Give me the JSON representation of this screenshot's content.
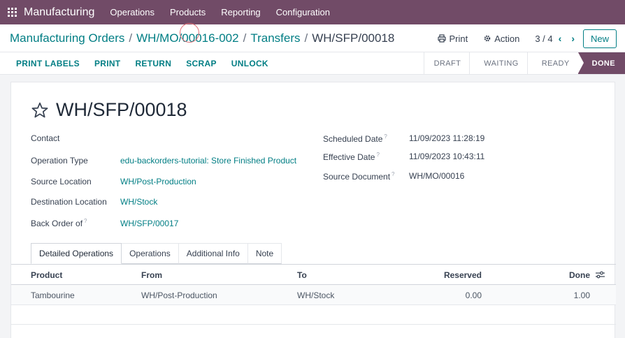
{
  "topbar": {
    "app_name": "Manufacturing",
    "menu": [
      "Operations",
      "Products",
      "Reporting",
      "Configuration"
    ]
  },
  "breadcrumb": {
    "items": [
      "Manufacturing Orders",
      "WH/MO/00016-002",
      "Transfers"
    ],
    "current": "WH/SFP/00018",
    "separator": "/"
  },
  "controls": {
    "print_label": "Print",
    "action_label": "Action",
    "pager": "3 / 4",
    "new_label": "New"
  },
  "actions": [
    "PRINT LABELS",
    "PRINT",
    "RETURN",
    "SCRAP",
    "UNLOCK"
  ],
  "stages": [
    "DRAFT",
    "WAITING",
    "READY",
    "DONE"
  ],
  "record": {
    "title": "WH/SFP/00018",
    "left_fields": [
      {
        "label": "Contact",
        "value": ""
      },
      {
        "label": "Operation Type",
        "value": "edu-backorders-tutorial: Store Finished Product"
      },
      {
        "label": "Source Location",
        "value": "WH/Post-Production"
      },
      {
        "label": "Destination Location",
        "value": "WH/Stock"
      },
      {
        "label": "Back Order of",
        "value": "WH/SFP/00017"
      }
    ],
    "right_fields": [
      {
        "label": "Scheduled Date",
        "value": "11/09/2023 11:28:19"
      },
      {
        "label": "Effective Date",
        "value": "11/09/2023 10:43:11"
      },
      {
        "label": "Source Document",
        "value": "WH/MO/00016"
      }
    ],
    "help_mark": "?"
  },
  "tabs": [
    "Detailed Operations",
    "Operations",
    "Additional Info",
    "Note"
  ],
  "table": {
    "headers": [
      "Product",
      "From",
      "To",
      "Reserved",
      "Done"
    ],
    "rows": [
      [
        "Tambourine",
        "WH/Post-Production",
        "WH/Stock",
        "0.00",
        "1.00"
      ]
    ]
  },
  "colors": {
    "brand": "#714b67",
    "link": "#017e84"
  }
}
